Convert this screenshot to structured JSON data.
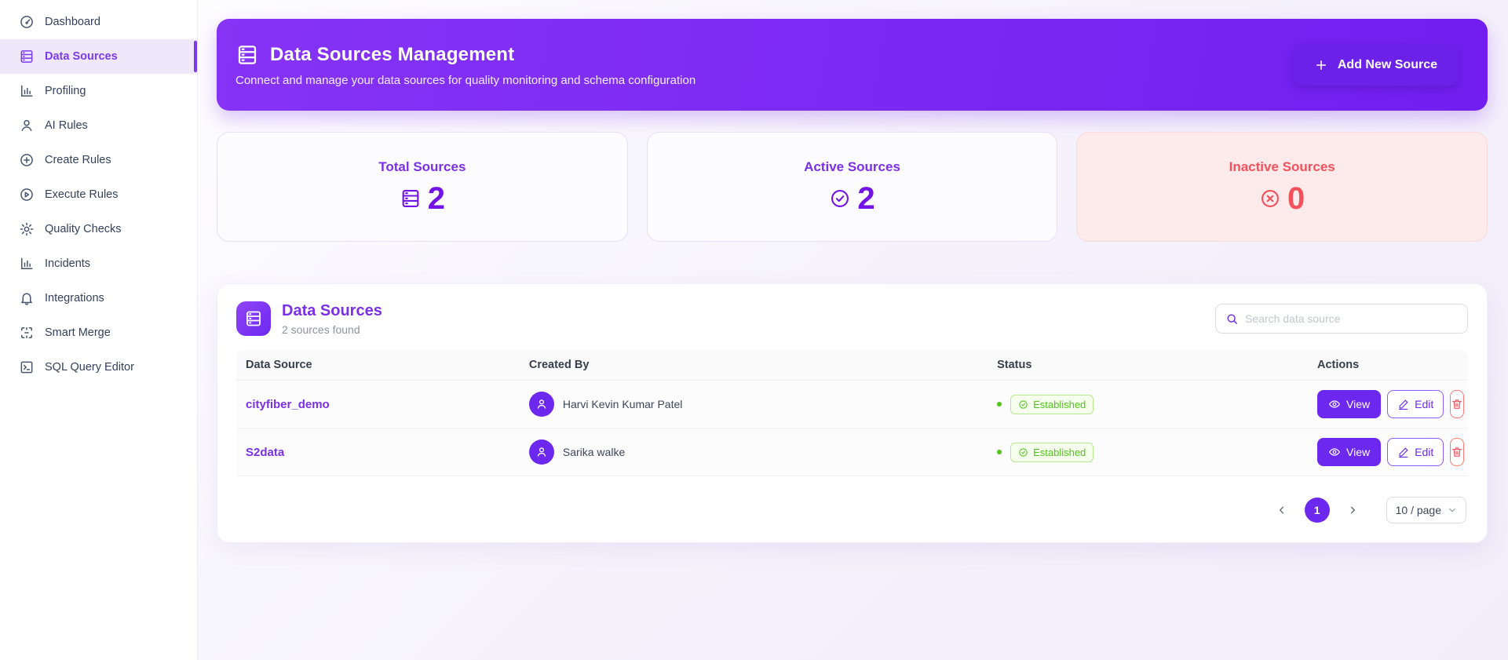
{
  "sidebar": {
    "items": [
      {
        "label": "Dashboard",
        "icon": "dashboard-icon",
        "active": false
      },
      {
        "label": "Data Sources",
        "icon": "database-icon",
        "active": true
      },
      {
        "label": "Profiling",
        "icon": "bar-chart-icon",
        "active": false
      },
      {
        "label": "AI Rules",
        "icon": "user-icon",
        "active": false
      },
      {
        "label": "Create Rules",
        "icon": "plus-circle-icon",
        "active": false
      },
      {
        "label": "Execute Rules",
        "icon": "play-circle-icon",
        "active": false
      },
      {
        "label": "Quality Checks",
        "icon": "gear-icon",
        "active": false
      },
      {
        "label": "Incidents",
        "icon": "bar-chart-icon",
        "active": false
      },
      {
        "label": "Integrations",
        "icon": "bell-icon",
        "active": false
      },
      {
        "label": "Smart Merge",
        "icon": "merge-icon",
        "active": false
      },
      {
        "label": "SQL Query Editor",
        "icon": "terminal-icon",
        "active": false
      }
    ]
  },
  "banner": {
    "title": "Data Sources Management",
    "subtitle": "Connect and manage your data sources for quality monitoring and schema configuration",
    "add_button_label": "Add New Source",
    "icon": "database-icon"
  },
  "stats": {
    "total": {
      "label": "Total Sources",
      "value": "2",
      "icon": "database-icon"
    },
    "active": {
      "label": "Active Sources",
      "value": "2",
      "icon": "check-circle-icon"
    },
    "inactive": {
      "label": "Inactive Sources",
      "value": "0",
      "icon": "x-circle-icon"
    }
  },
  "table_card": {
    "title": "Data Sources",
    "subtitle": "2 sources found",
    "search_placeholder": "Search data source",
    "columns": {
      "source": "Data Source",
      "created_by": "Created By",
      "status": "Status",
      "actions": "Actions"
    },
    "rows": [
      {
        "name": "cityfiber_demo",
        "created_by": "Harvi Kevin Kumar Patel",
        "status": "Established",
        "view_label": "View",
        "edit_label": "Edit"
      },
      {
        "name": "S2data",
        "created_by": "Sarika walke",
        "status": "Established",
        "view_label": "View",
        "edit_label": "Edit"
      }
    ]
  },
  "pagination": {
    "current_page": "1",
    "page_size": "10 / page"
  },
  "colors": {
    "primary": "#6d28f0",
    "banner_gradient_from": "#8633f6",
    "banner_gradient_to": "#721ef0",
    "active_item": "#7c3aed",
    "danger": "#f4515c",
    "danger_bg": "#fdeaea",
    "success": "#52c41a",
    "success_bg": "#f6ffed",
    "success_border": "#b7eb8f"
  }
}
